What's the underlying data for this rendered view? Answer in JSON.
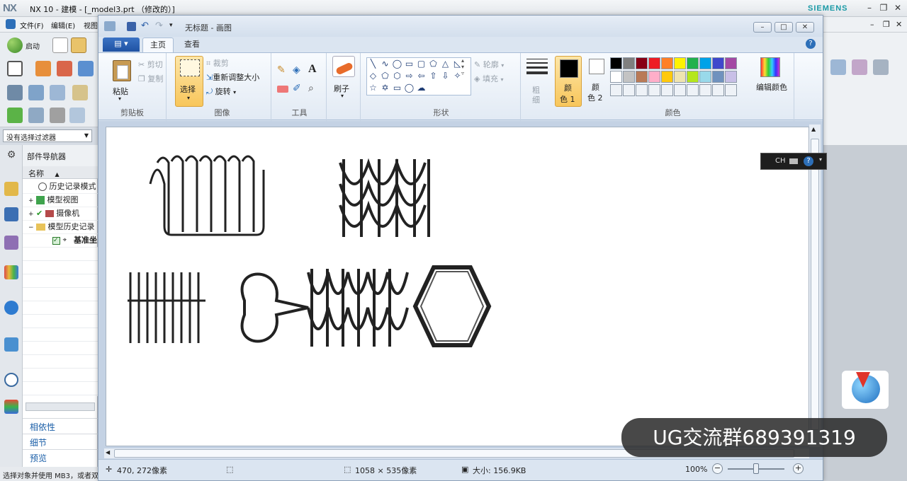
{
  "nx": {
    "logo": "NX",
    "title": "NX 10 - 建模 - [_model3.prt （修改的）]",
    "brand": "SIEMENS",
    "menu": [
      "文件(F)",
      "编辑(E)",
      "视图"
    ],
    "start_label": "启动",
    "filter": "没有选择过滤器",
    "navigator": {
      "title": "部件导航器",
      "column": "名称",
      "rows": [
        "历史记录模式",
        "模型视图",
        "摄像机",
        "模型历史记录",
        "基准坐"
      ],
      "bottom": [
        "相依性",
        "细节",
        "预览"
      ]
    },
    "status": "选择对象并使用 MB3，或者双"
  },
  "paint": {
    "title": "无标题 - 画图",
    "tabs": [
      "主页",
      "查看"
    ],
    "clipboard": {
      "paste": "粘贴",
      "cut": "剪切",
      "copy": "复制",
      "label": "剪贴板"
    },
    "image": {
      "select": "选择",
      "crop": "裁剪",
      "resize": "重新调整大小",
      "rotate": "旋转",
      "label": "图像"
    },
    "tools": {
      "label": "工具",
      "text_tool": "A"
    },
    "brushes": {
      "label": "刷子"
    },
    "shapes": {
      "outline": "轮廓",
      "fill": "填充",
      "label": "形状"
    },
    "size": {
      "label1": "粗",
      "label2": "细"
    },
    "colors": {
      "color1_a": "颜",
      "color1_b": "色 1",
      "color2_a": "颜",
      "color2_b": "色 2",
      "edit": "编辑颜色",
      "label": "颜色",
      "palette_row1": [
        "#000000",
        "#7f7f7f",
        "#880015",
        "#ed1c24",
        "#ff7f27",
        "#fff200",
        "#22b14c",
        "#00a2e8",
        "#3f48cc",
        "#a349a4"
      ],
      "palette_row2": [
        "#ffffff",
        "#c3c3c3",
        "#b97a57",
        "#ffaec9",
        "#ffc90e",
        "#efe4b0",
        "#b5e61d",
        "#99d9ea",
        "#7092be",
        "#c8bfe7"
      ]
    },
    "status": {
      "cursor": "470, 272像素",
      "dimensions": "1058 × 535像素",
      "size": "大小: 156.9KB",
      "zoom": "100%"
    }
  },
  "ime": "CH",
  "banner": "UG交流群689391319"
}
